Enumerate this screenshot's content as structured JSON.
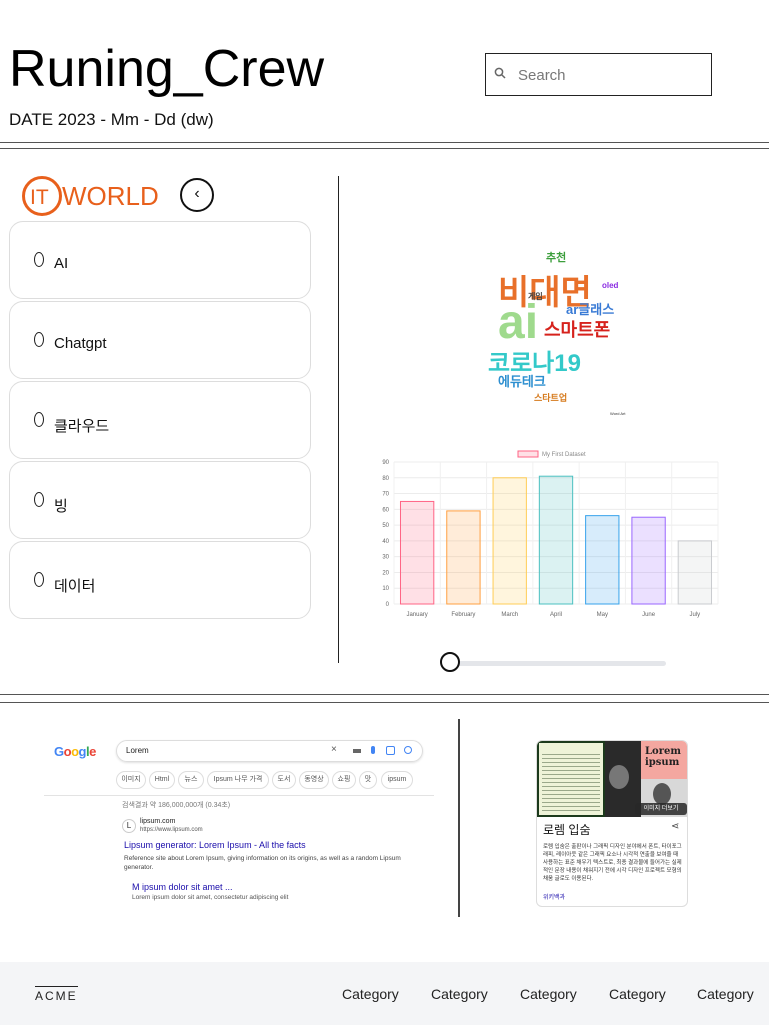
{
  "header": {
    "title": "Runing_Crew",
    "date": "DATE 2023 - Mm - Dd (dw)",
    "search_placeholder": "Search"
  },
  "sidebar": {
    "logo_text": "ITWORLD",
    "logo_prefix": "IT",
    "logo_suffix": "WORLD",
    "back_glyph": "‹",
    "items": [
      {
        "label": "AI"
      },
      {
        "label": "Chatgpt"
      },
      {
        "label": "클라우드"
      },
      {
        "label": "빙"
      },
      {
        "label": "데이터"
      }
    ]
  },
  "wordcloud": {
    "words": [
      "비대면",
      "ai",
      "코로나19",
      "스마트폰",
      "ar글래스",
      "에듀테크",
      "추천",
      "스타트업",
      "게임",
      "oled"
    ],
    "caption": "Word Art"
  },
  "chart_data": {
    "type": "bar",
    "title": "",
    "legend": "My First Dataset",
    "categories": [
      "January",
      "February",
      "March",
      "April",
      "May",
      "June",
      "July"
    ],
    "values": [
      65,
      59,
      80,
      81,
      56,
      55,
      40
    ],
    "ylim": [
      0,
      90
    ],
    "yticks": [
      0,
      10,
      20,
      30,
      40,
      50,
      60,
      70,
      80,
      90
    ],
    "grid": true,
    "colors": [
      "#ff6384",
      "#ff9f40",
      "#ffcd56",
      "#4bc0c0",
      "#36a2eb",
      "#9966ff",
      "#c9cbcf"
    ]
  },
  "slider": {
    "value": 0
  },
  "google": {
    "logo": "Google",
    "query": "Lorem",
    "chips": [
      "이미지",
      "Html",
      "뉴스",
      "Ipsum 나무 가격",
      "도서",
      "동영상",
      "쇼핑",
      "맛",
      "ipsum"
    ],
    "result_count": "검색결과 약 186,000,000개 (0.34초)",
    "site_name": "lipsum.com",
    "site_url": "https://www.lipsum.com",
    "result_title": "Lipsum generator: Lorem Ipsum - All the facts",
    "result_snippet": "Reference site about Lorem Ipsum, giving information on its origins, as well as a random Lipsum generator.",
    "sub_title": "M ipsum dolor sit amet ...",
    "sub_snippet": "Lorem ipsum dolor sit amet, consectetur adipiscing elit"
  },
  "knowledge": {
    "image_text": "Lorem ipsum",
    "more_label": "이미지 더보기",
    "title": "로렘 입숨",
    "desc": "로렘 입숨은 출판이나 그래픽 디자인 분야에서 폰트, 타이포그래피, 레이아웃 같은 그래픽 요소나 시각적 연출을 보여줄 때 사용하는 표준 채우기 텍스트로, 최종 결과물에 들어가는 실제적인 문장 내용이 채워지기 전에 시각 디자인 프로젝트 모형의 채움 글로도 이용된다.",
    "wiki": "위키백과"
  },
  "footer": {
    "brand": "ACME",
    "categories": [
      "Category",
      "Category",
      "Category",
      "Category",
      "Category"
    ]
  }
}
